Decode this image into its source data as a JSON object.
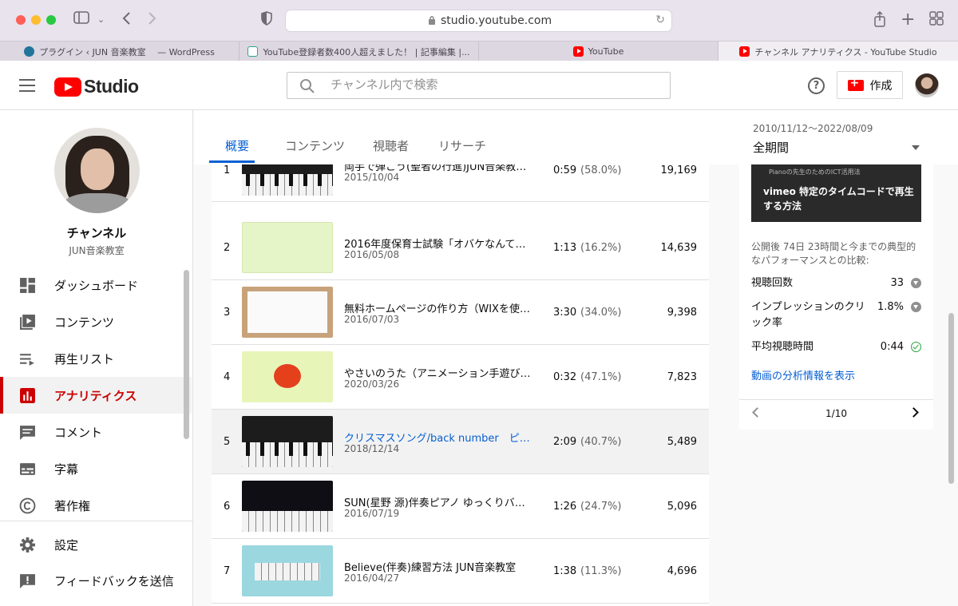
{
  "browser": {
    "url": "studio.youtube.com",
    "tabs": [
      {
        "label": "プラグイン ‹ JUN 音楽教室 　— WordPress",
        "favicon": "wordpress-icon"
      },
      {
        "label": "YouTube登録者数400人超えました！ | 記事編集 |...",
        "favicon": "document-icon"
      },
      {
        "label": "YouTube",
        "favicon": "youtube-icon"
      },
      {
        "label": "チャンネル アナリティクス - YouTube Studio",
        "favicon": "youtube-icon"
      }
    ]
  },
  "header": {
    "logo_text": "Studio",
    "search_placeholder": "チャンネル内で検索",
    "create_label": "作成",
    "help_glyph": "?"
  },
  "sidebar": {
    "channel_title": "チャンネル",
    "channel_name": "JUN音楽教室",
    "items": [
      {
        "label": "ダッシュボード",
        "icon": "dashboard-icon"
      },
      {
        "label": "コンテンツ",
        "icon": "content-icon"
      },
      {
        "label": "再生リスト",
        "icon": "playlist-icon"
      },
      {
        "label": "アナリティクス",
        "icon": "analytics-icon",
        "active": true
      },
      {
        "label": "コメント",
        "icon": "comment-icon"
      },
      {
        "label": "字幕",
        "icon": "subtitles-icon"
      },
      {
        "label": "著作権",
        "icon": "copyright-icon"
      }
    ],
    "bottom_items": [
      {
        "label": "設定",
        "icon": "settings-icon"
      },
      {
        "label": "フィードバックを送信",
        "icon": "feedback-icon"
      }
    ]
  },
  "tabs": [
    {
      "label": "概要",
      "active": true
    },
    {
      "label": "コンテンツ"
    },
    {
      "label": "視聴者"
    },
    {
      "label": "リサーチ"
    }
  ],
  "date_range": {
    "range": "2010/11/12〜2022/08/09",
    "label": "全期間"
  },
  "videos": [
    {
      "rank": "1",
      "title": "両手で弾こう(聖者の行進)JUN音楽教室 ...",
      "date": "2015/10/04",
      "duration": "0:59",
      "percent": "(58.0%)",
      "views": "19,169"
    },
    {
      "rank": "2",
      "title": "2016年度保育士試験「オバケなんてない...",
      "date": "2016/05/08",
      "duration": "1:13",
      "percent": "(16.2%)",
      "views": "14,639"
    },
    {
      "rank": "3",
      "title": "無料ホームページの作り方（WIXを使っ...",
      "date": "2016/07/03",
      "duration": "3:30",
      "percent": "(34.0%)",
      "views": "9,398"
    },
    {
      "rank": "4",
      "title": "やさいのうた（アニメーション手遊び歌...",
      "date": "2020/03/26",
      "duration": "0:32",
      "percent": "(47.1%)",
      "views": "7,823"
    },
    {
      "rank": "5",
      "title": "クリスマスソング/back number　ピアノ...",
      "date": "2018/12/14",
      "duration": "2:09",
      "percent": "(40.7%)",
      "views": "5,489"
    },
    {
      "rank": "6",
      "title": "SUN(星野 源)伴奏ピアノ ゆっくりバージ...",
      "date": "2016/07/19",
      "duration": "1:26",
      "percent": "(24.7%)",
      "views": "5,096"
    },
    {
      "rank": "7",
      "title": "Believe(伴奏)練習方法 JUN音楽教室",
      "date": "2016/04/27",
      "duration": "1:38",
      "percent": "(11.3%)",
      "views": "4,696"
    }
  ],
  "card": {
    "thumb_small": "Pianoの先生のためのICT活用法",
    "thumb_title": "vimeo 特定のタイムコードで再生する方法",
    "description": "公開後 74日 23時間と今までの典型的なパフォーマンスとの比較:",
    "metrics": [
      {
        "label": "視聴回数",
        "value": "33",
        "status": "down"
      },
      {
        "label": "インプレッションのクリック率",
        "value": "1.8%",
        "status": "down"
      },
      {
        "label": "平均視聴時間",
        "value": "0:44",
        "status": "ok"
      }
    ],
    "link": "動画の分析情報を表示",
    "pager": "1/10"
  },
  "colors": {
    "accent_blue": "#065fd4",
    "active_red": "#cc0000",
    "youtube_red": "#ff0000"
  }
}
